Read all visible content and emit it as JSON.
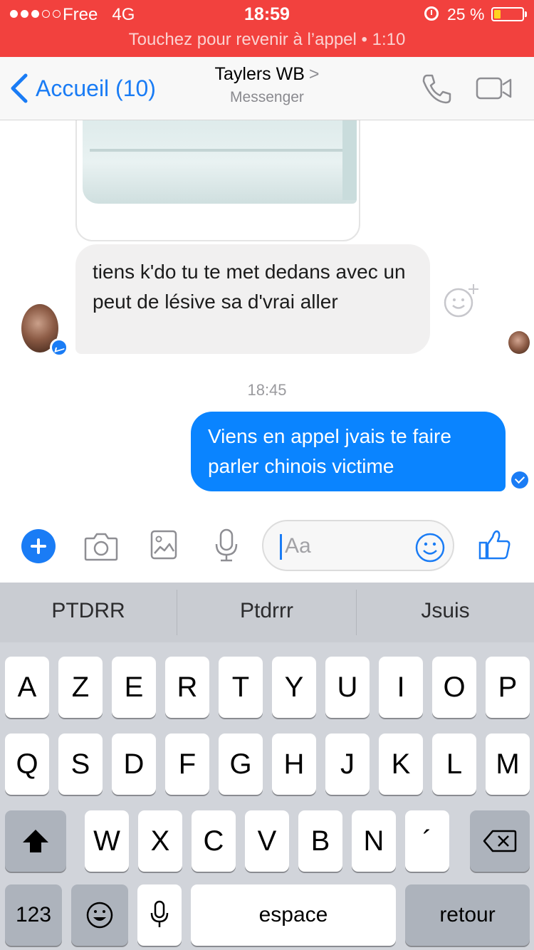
{
  "status_bar": {
    "carrier": "Free",
    "network": "4G",
    "time": "18:59",
    "battery_percent": "25 %",
    "call_banner": "Touchez pour revenir à l’appel • 1:10",
    "background_color": "#f2413e"
  },
  "nav": {
    "back_label": "Accueil (10)",
    "title": "Taylers WB",
    "title_chevron": ">",
    "subtitle": "Messenger",
    "accent_color": "#1a7cf5"
  },
  "conversation": {
    "incoming_message": "tiens k'do tu te met dedans avec un peut de lésive sa d'vrai aller",
    "timestamp": "18:45",
    "outgoing_message": "Viens en appel jvais te faire parler chinois victime",
    "outgoing_bubble_color": "#0a84ff"
  },
  "composer": {
    "placeholder": "Aa"
  },
  "keyboard": {
    "predictions": [
      "PTDRR",
      "Ptdrrr",
      "Jsuis"
    ],
    "row1": [
      "A",
      "Z",
      "E",
      "R",
      "T",
      "Y",
      "U",
      "I",
      "O",
      "P"
    ],
    "row2": [
      "Q",
      "S",
      "D",
      "F",
      "G",
      "H",
      "J",
      "K",
      "L",
      "M"
    ],
    "row3": [
      "W",
      "X",
      "C",
      "V",
      "B",
      "N",
      "´"
    ],
    "numbers_label": "123",
    "space_label": "espace",
    "return_label": "retour"
  }
}
